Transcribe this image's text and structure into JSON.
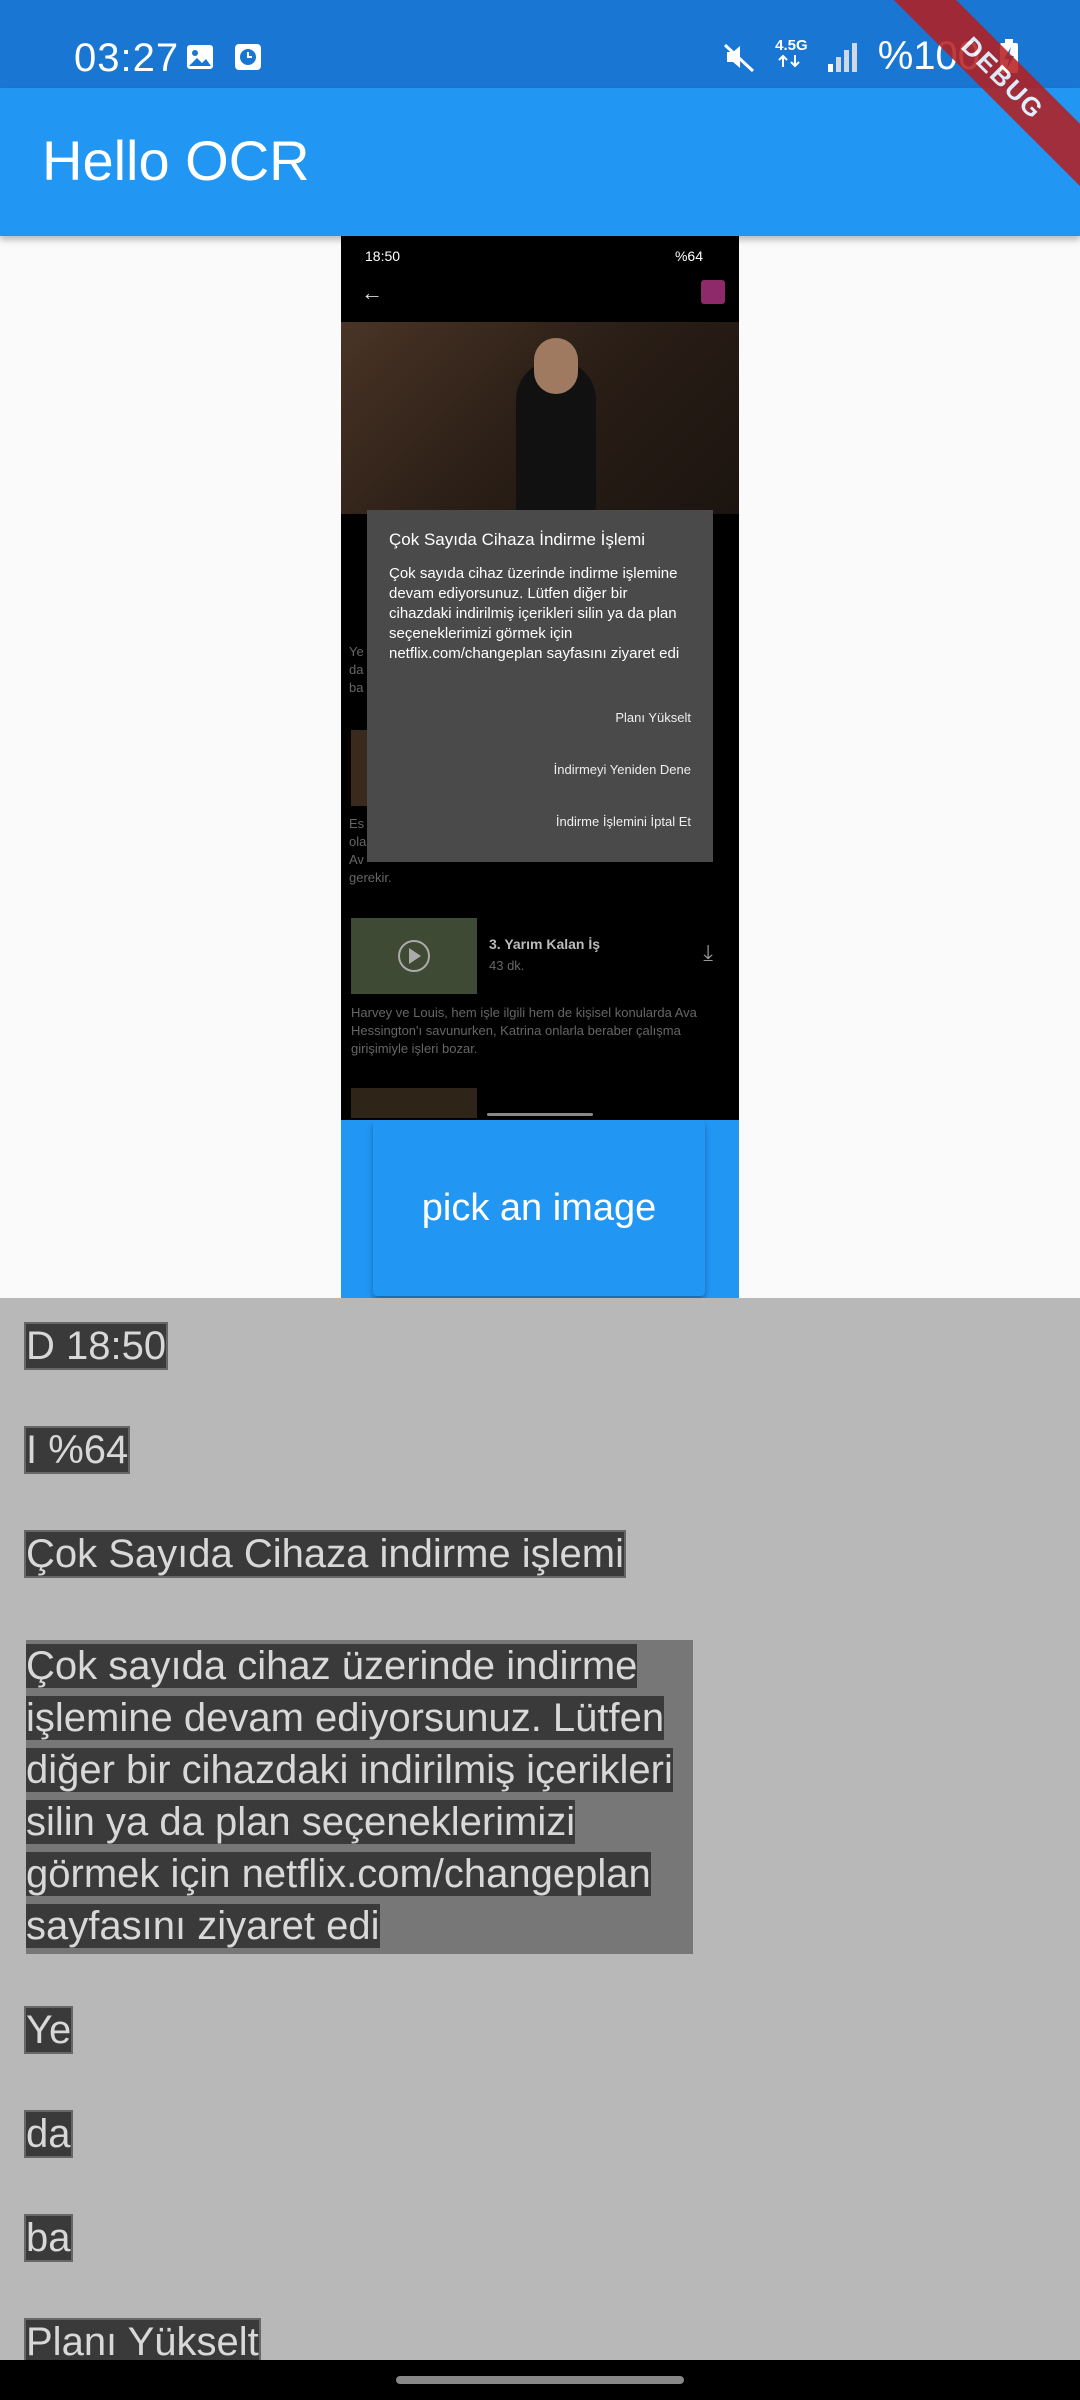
{
  "status_bar": {
    "time": "03:27",
    "network": "4.5G",
    "battery": "%100"
  },
  "debug_banner": "DEBUG",
  "app_bar": {
    "title": "Hello OCR"
  },
  "picked_image": {
    "status_time": "18:50",
    "status_battery": "%64",
    "dialog": {
      "title": "Çok Sayıda Cihaza İndirme İşlemi",
      "body": "Çok sayıda cihaz üzerinde indirme işlemine devam ediyorsunuz. Lütfen diğer bir cihazdaki indirilmiş içerikleri silin ya da plan seçeneklerimizi görmek için netflix.com/changeplan sayfasını ziyaret edi",
      "actions": [
        "Planı Yükselt",
        "İndirmeyi Yeniden Dene",
        "İndirme İşlemini İptal Et"
      ]
    },
    "episode": {
      "title": "3. Yarım Kalan İş",
      "duration": "43 dk.",
      "description": "Harvey ve Louis, hem işle ilgili hem de kişisel konularda Ava Hessington'ı savunurken, Katrina onlarla beraber çalışma girişimiyle işleri bozar."
    },
    "partial_text_1": "Ye",
    "partial_text_2": "da",
    "partial_text_3": "ba",
    "partial_text_4": "Es",
    "partial_text_5": "ola",
    "partial_text_6": "Av",
    "partial_text_7": "gerekir."
  },
  "pick_button": {
    "label": "pick an image"
  },
  "ocr_results": {
    "item_1": "D 18:50",
    "item_2": "I %64",
    "item_3": "Çok Sayıda Cihaza indirme işlemi",
    "paragraph": [
      "Çok sayıda cihaz üzerinde indirme",
      "işlemine devam ediyorsunuz. Lütfen",
      "diğer bir cihazdaki indirilmiş içerikleri",
      "silin ya da plan seçeneklerimizi",
      "görmek için netflix.com/changeplan",
      "sayfasını ziyaret edi"
    ],
    "item_5": "Ye",
    "item_6": "da",
    "item_7": "ba",
    "item_8": "Planı Yükselt"
  }
}
